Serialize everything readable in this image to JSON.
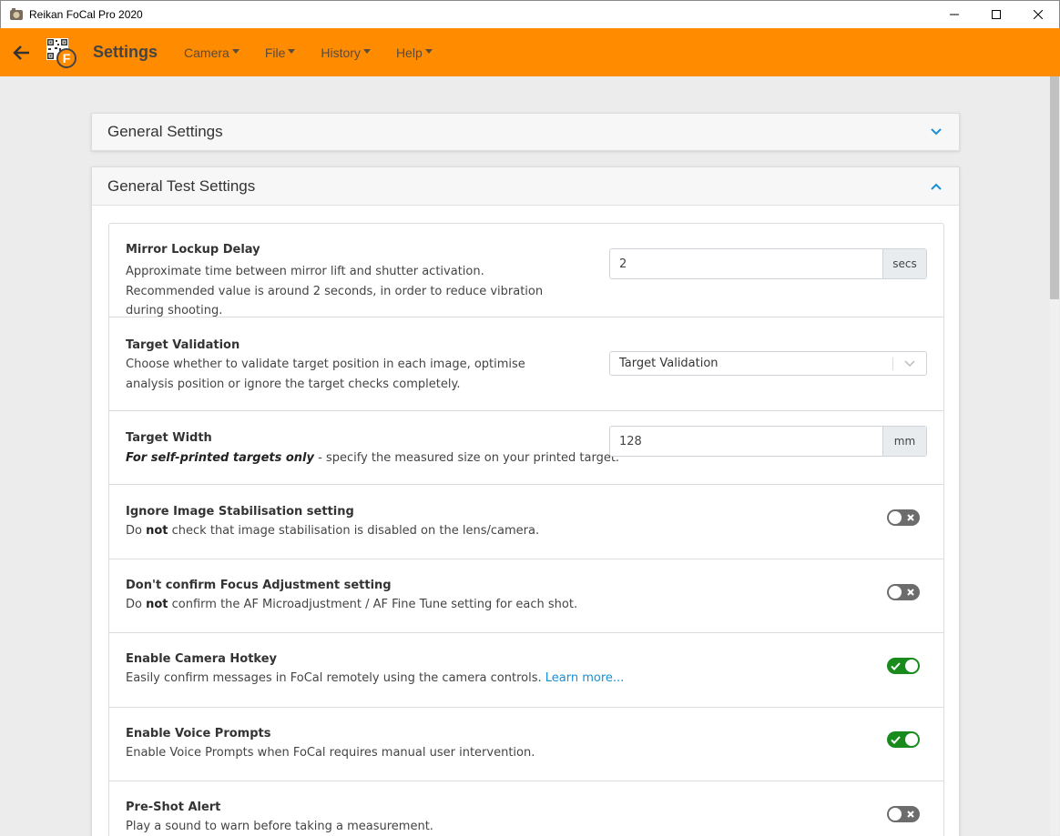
{
  "window": {
    "title": "Reikan FoCal Pro 2020"
  },
  "header": {
    "title": "Settings",
    "menu": [
      {
        "label": "Camera"
      },
      {
        "label": "File"
      },
      {
        "label": "History"
      },
      {
        "label": "Help"
      }
    ]
  },
  "accent_color": "#ff8c00",
  "sections": {
    "general": {
      "title": "General Settings",
      "expanded": false
    },
    "test": {
      "title": "General Test Settings",
      "expanded": true
    }
  },
  "settings": {
    "mirror_lockup": {
      "title": "Mirror Lockup Delay",
      "desc": "Approximate time between mirror lift and shutter activation. Recommended value is around 2 seconds, in order to reduce vibration during shooting.",
      "value": "2",
      "unit": "secs"
    },
    "target_validation": {
      "title": "Target Validation",
      "desc": "Choose whether to validate target position in each image, optimise analysis position or ignore the target checks completely.",
      "value": "Target Validation"
    },
    "target_width": {
      "title": "Target Width",
      "desc_em": "For self-printed targets only",
      "desc_rest": " - specify the measured size on your printed target.",
      "value": "128",
      "unit": "mm"
    },
    "ignore_is": {
      "title": "Ignore Image Stabilisation setting",
      "desc_pre": "Do ",
      "desc_bold": "not",
      "desc_post": " check that image stabilisation is disabled on the lens/camera.",
      "enabled": false
    },
    "no_confirm_focus": {
      "title": "Don't confirm Focus Adjustment setting",
      "desc_pre": "Do ",
      "desc_bold": "not",
      "desc_post": " confirm the AF Microadjustment / AF Fine Tune setting for each shot.",
      "enabled": false
    },
    "camera_hotkey": {
      "title": "Enable Camera Hotkey",
      "desc": "Easily confirm messages in FoCal remotely using the camera controls. ",
      "link": "Learn more...",
      "enabled": true
    },
    "voice_prompts": {
      "title": "Enable Voice Prompts",
      "desc": "Enable Voice Prompts when FoCal requires manual user intervention.",
      "enabled": true
    },
    "pre_shot_alert": {
      "title": "Pre-Shot Alert",
      "desc": "Play a sound to warn before taking a measurement.",
      "enabled": false
    }
  }
}
